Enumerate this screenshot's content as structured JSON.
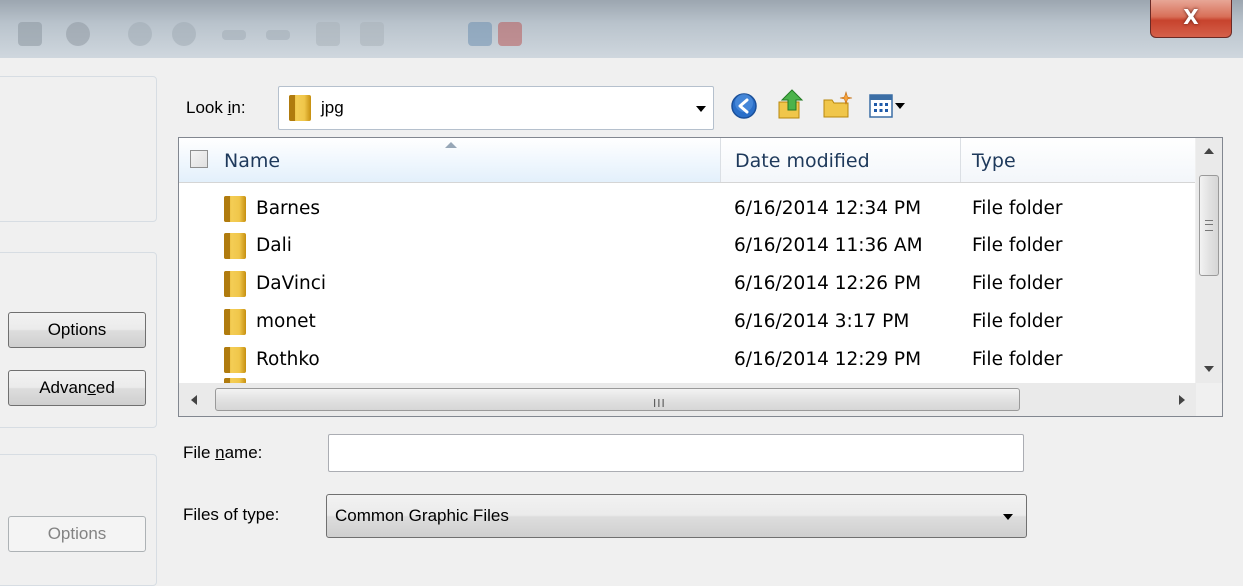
{
  "window": {
    "close_glyph": "X"
  },
  "left_panel": {
    "options_label": "Options",
    "advanced_label_pre": "Advan",
    "advanced_label_key": "c",
    "advanced_label_post": "ed",
    "options2_label": "Options"
  },
  "look_in": {
    "label_pre": "Look ",
    "label_key": "i",
    "label_post": "n:",
    "value": "jpg"
  },
  "toolbar": {
    "icons": [
      "back-icon",
      "up-folder-icon",
      "new-folder-icon",
      "view-menu-icon"
    ]
  },
  "file_list": {
    "columns": [
      "Name",
      "Date modified",
      "Type"
    ],
    "rows": [
      {
        "name": "Barnes",
        "date": "6/16/2014 12:34 PM",
        "type": "File folder"
      },
      {
        "name": "Dali",
        "date": "6/16/2014 11:36 AM",
        "type": "File folder"
      },
      {
        "name": "DaVinci",
        "date": "6/16/2014 12:26 PM",
        "type": "File folder"
      },
      {
        "name": "monet",
        "date": "6/16/2014 3:17 PM",
        "type": "File folder"
      },
      {
        "name": "Rothko",
        "date": "6/16/2014 12:29 PM",
        "type": "File folder"
      }
    ],
    "hscroll_grip": "III"
  },
  "file_name": {
    "label_pre": "File ",
    "label_key": "n",
    "label_post": "ame:",
    "value": ""
  },
  "files_of_type": {
    "label": "Files of type:",
    "selected": "Common Graphic Files"
  },
  "colors": {
    "header_text": "#1e395b",
    "close_button": "#c7432d",
    "folder": "#f0c64a"
  }
}
